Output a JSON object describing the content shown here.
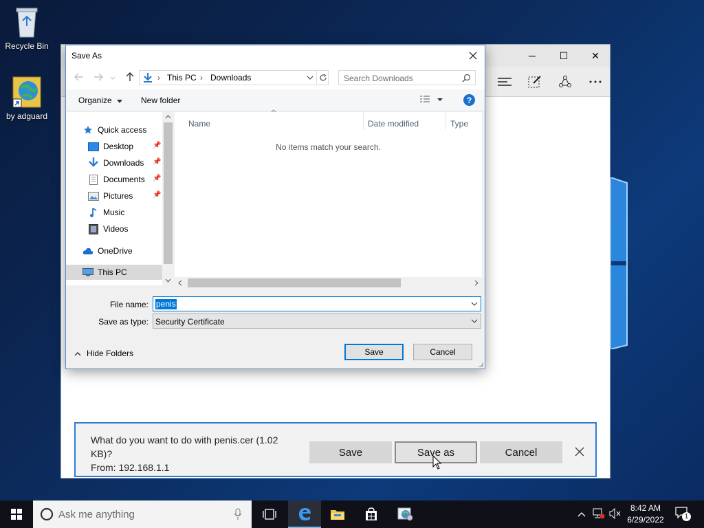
{
  "desktop": {
    "icons": [
      {
        "label": "Recycle Bin"
      },
      {
        "label": "by adguard"
      }
    ]
  },
  "edge": {
    "controls": {
      "minimize": "─",
      "maximize": "☐",
      "close": "✕"
    }
  },
  "dialog": {
    "title": "Save As",
    "address": {
      "segments": [
        "This PC",
        "Downloads"
      ]
    },
    "search_placeholder": "Search Downloads",
    "organize_label": "Organize",
    "new_folder_label": "New folder",
    "help_label": "?",
    "nav": {
      "quick_access": "Quick access",
      "desktop": "Desktop",
      "downloads": "Downloads",
      "documents": "Documents",
      "pictures": "Pictures",
      "music": "Music",
      "videos": "Videos",
      "onedrive": "OneDrive",
      "this_pc": "This PC"
    },
    "columns": {
      "name": "Name",
      "date": "Date modified",
      "type": "Type"
    },
    "empty_message": "No items match your search.",
    "file_name_label": "File name:",
    "file_name_value": "penis",
    "save_type_label": "Save as type:",
    "save_type_value": "Security Certificate",
    "hide_folders_label": "Hide Folders",
    "save_label": "Save",
    "cancel_label": "Cancel"
  },
  "download_bar": {
    "line1": "What do you want to do with penis.cer (1.02",
    "line2": "KB)?",
    "line3": "From: 192.168.1.1",
    "save_label": "Save",
    "save_as_label": "Save as",
    "cancel_label": "Cancel"
  },
  "taskbar": {
    "search_placeholder": "Ask me anything",
    "time": "8:42 AM",
    "date": "6/29/2022",
    "notification_count": "1"
  }
}
